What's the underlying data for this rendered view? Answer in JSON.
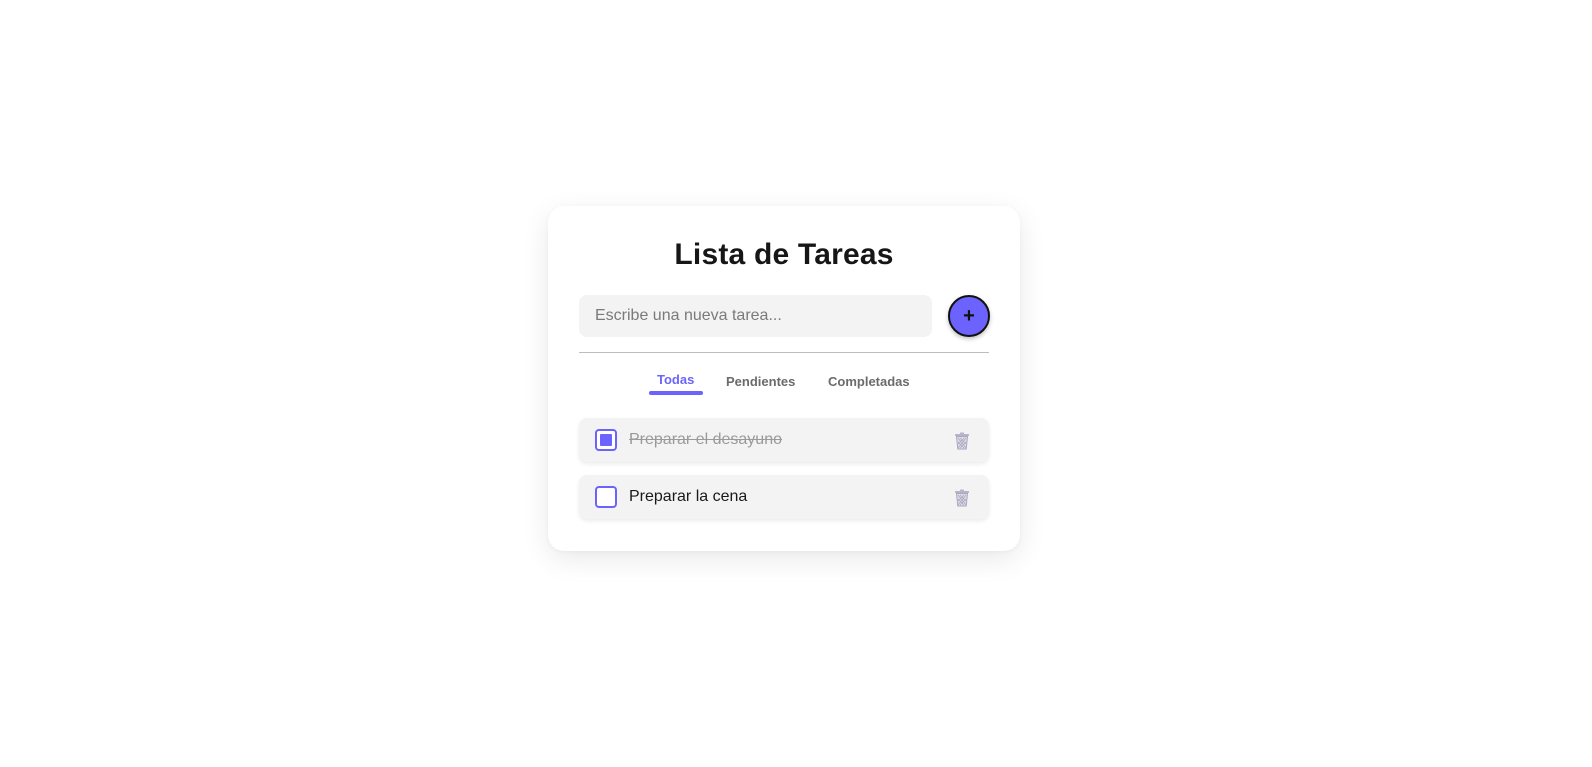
{
  "app": {
    "title": "Lista de Tareas"
  },
  "input": {
    "placeholder": "Escribe una nueva tarea...",
    "value": ""
  },
  "add_button": {
    "label": "+"
  },
  "tabs": [
    {
      "label": "Todas",
      "active": true
    },
    {
      "label": "Pendientes",
      "active": false
    },
    {
      "label": "Completadas",
      "active": false
    }
  ],
  "tasks": [
    {
      "text": "Preparar el desayuno",
      "completed": true,
      "delete_icon": "trash-icon"
    },
    {
      "text": "Preparar la cena",
      "completed": false,
      "delete_icon": "trash-icon"
    }
  ],
  "colors": {
    "accent": "#6c63ff",
    "muted_text": "#6b6b6b",
    "item_background": "#f3f3f3"
  }
}
